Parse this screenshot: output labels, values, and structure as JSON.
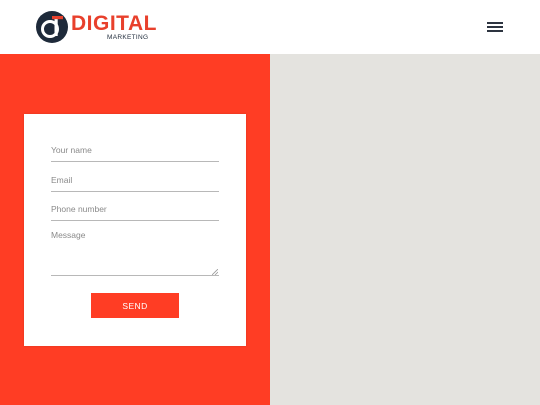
{
  "header": {
    "logo": {
      "word": "DIGITAL",
      "sub": "MARKETING",
      "icon": "logo-mark-icon"
    },
    "menu": {
      "icon": "hamburger-menu-icon"
    }
  },
  "form": {
    "name_placeholder": "Your name",
    "email_placeholder": "Email",
    "phone_placeholder": "Phone number",
    "message_placeholder": "Message",
    "send_label": "SEND"
  },
  "colors": {
    "accent": "#ff3d24",
    "map_gray": "#e4e3df",
    "logo_red": "#e8402c",
    "logo_navy": "#1e2a3a"
  }
}
